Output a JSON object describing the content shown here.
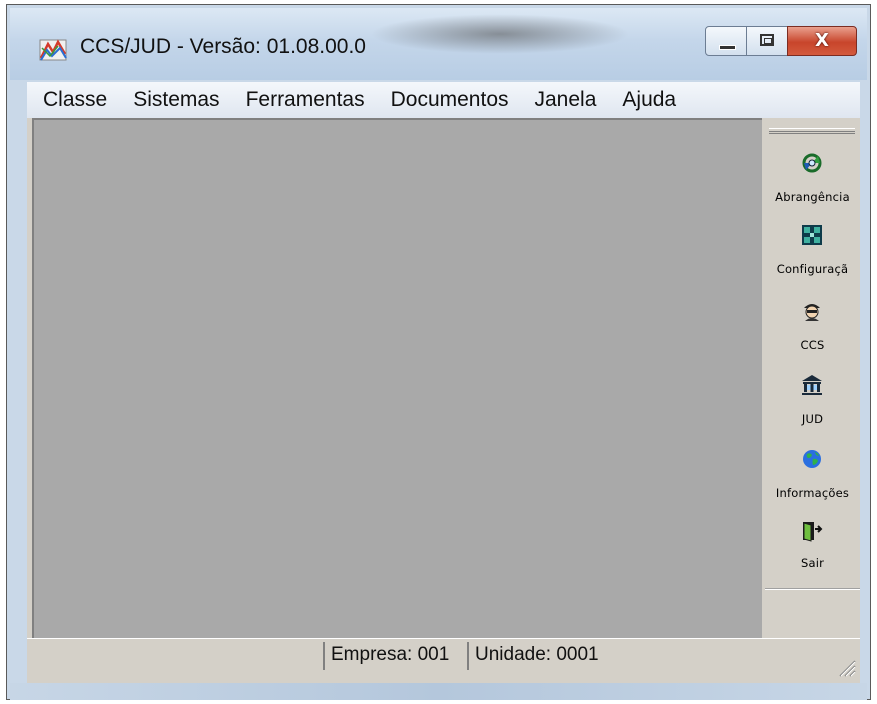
{
  "window": {
    "title": "CCS/JUD - Versão: 01.08.00.0",
    "close_glyph": "X"
  },
  "menu": [
    "Classe",
    "Sistemas",
    "Ferramentas",
    "Documentos",
    "Janela",
    "Ajuda"
  ],
  "toolbar": [
    {
      "label": "Abrangência",
      "icon": "refresh-arrows-icon"
    },
    {
      "label": "Configuraçã",
      "icon": "grid-config-icon"
    },
    {
      "label": "CCS",
      "icon": "agent-face-icon"
    },
    {
      "label": "JUD",
      "icon": "courthouse-icon"
    },
    {
      "label": "Informações",
      "icon": "globe-icon"
    },
    {
      "label": "Sair",
      "icon": "exit-door-icon"
    }
  ],
  "status": {
    "empresa": "Empresa: 001",
    "unidade": "Unidade: 0001"
  },
  "colors": {
    "workspace": "#a9a9a9",
    "toolbar": "#d4d0c8",
    "close_button": "#c8452b"
  }
}
